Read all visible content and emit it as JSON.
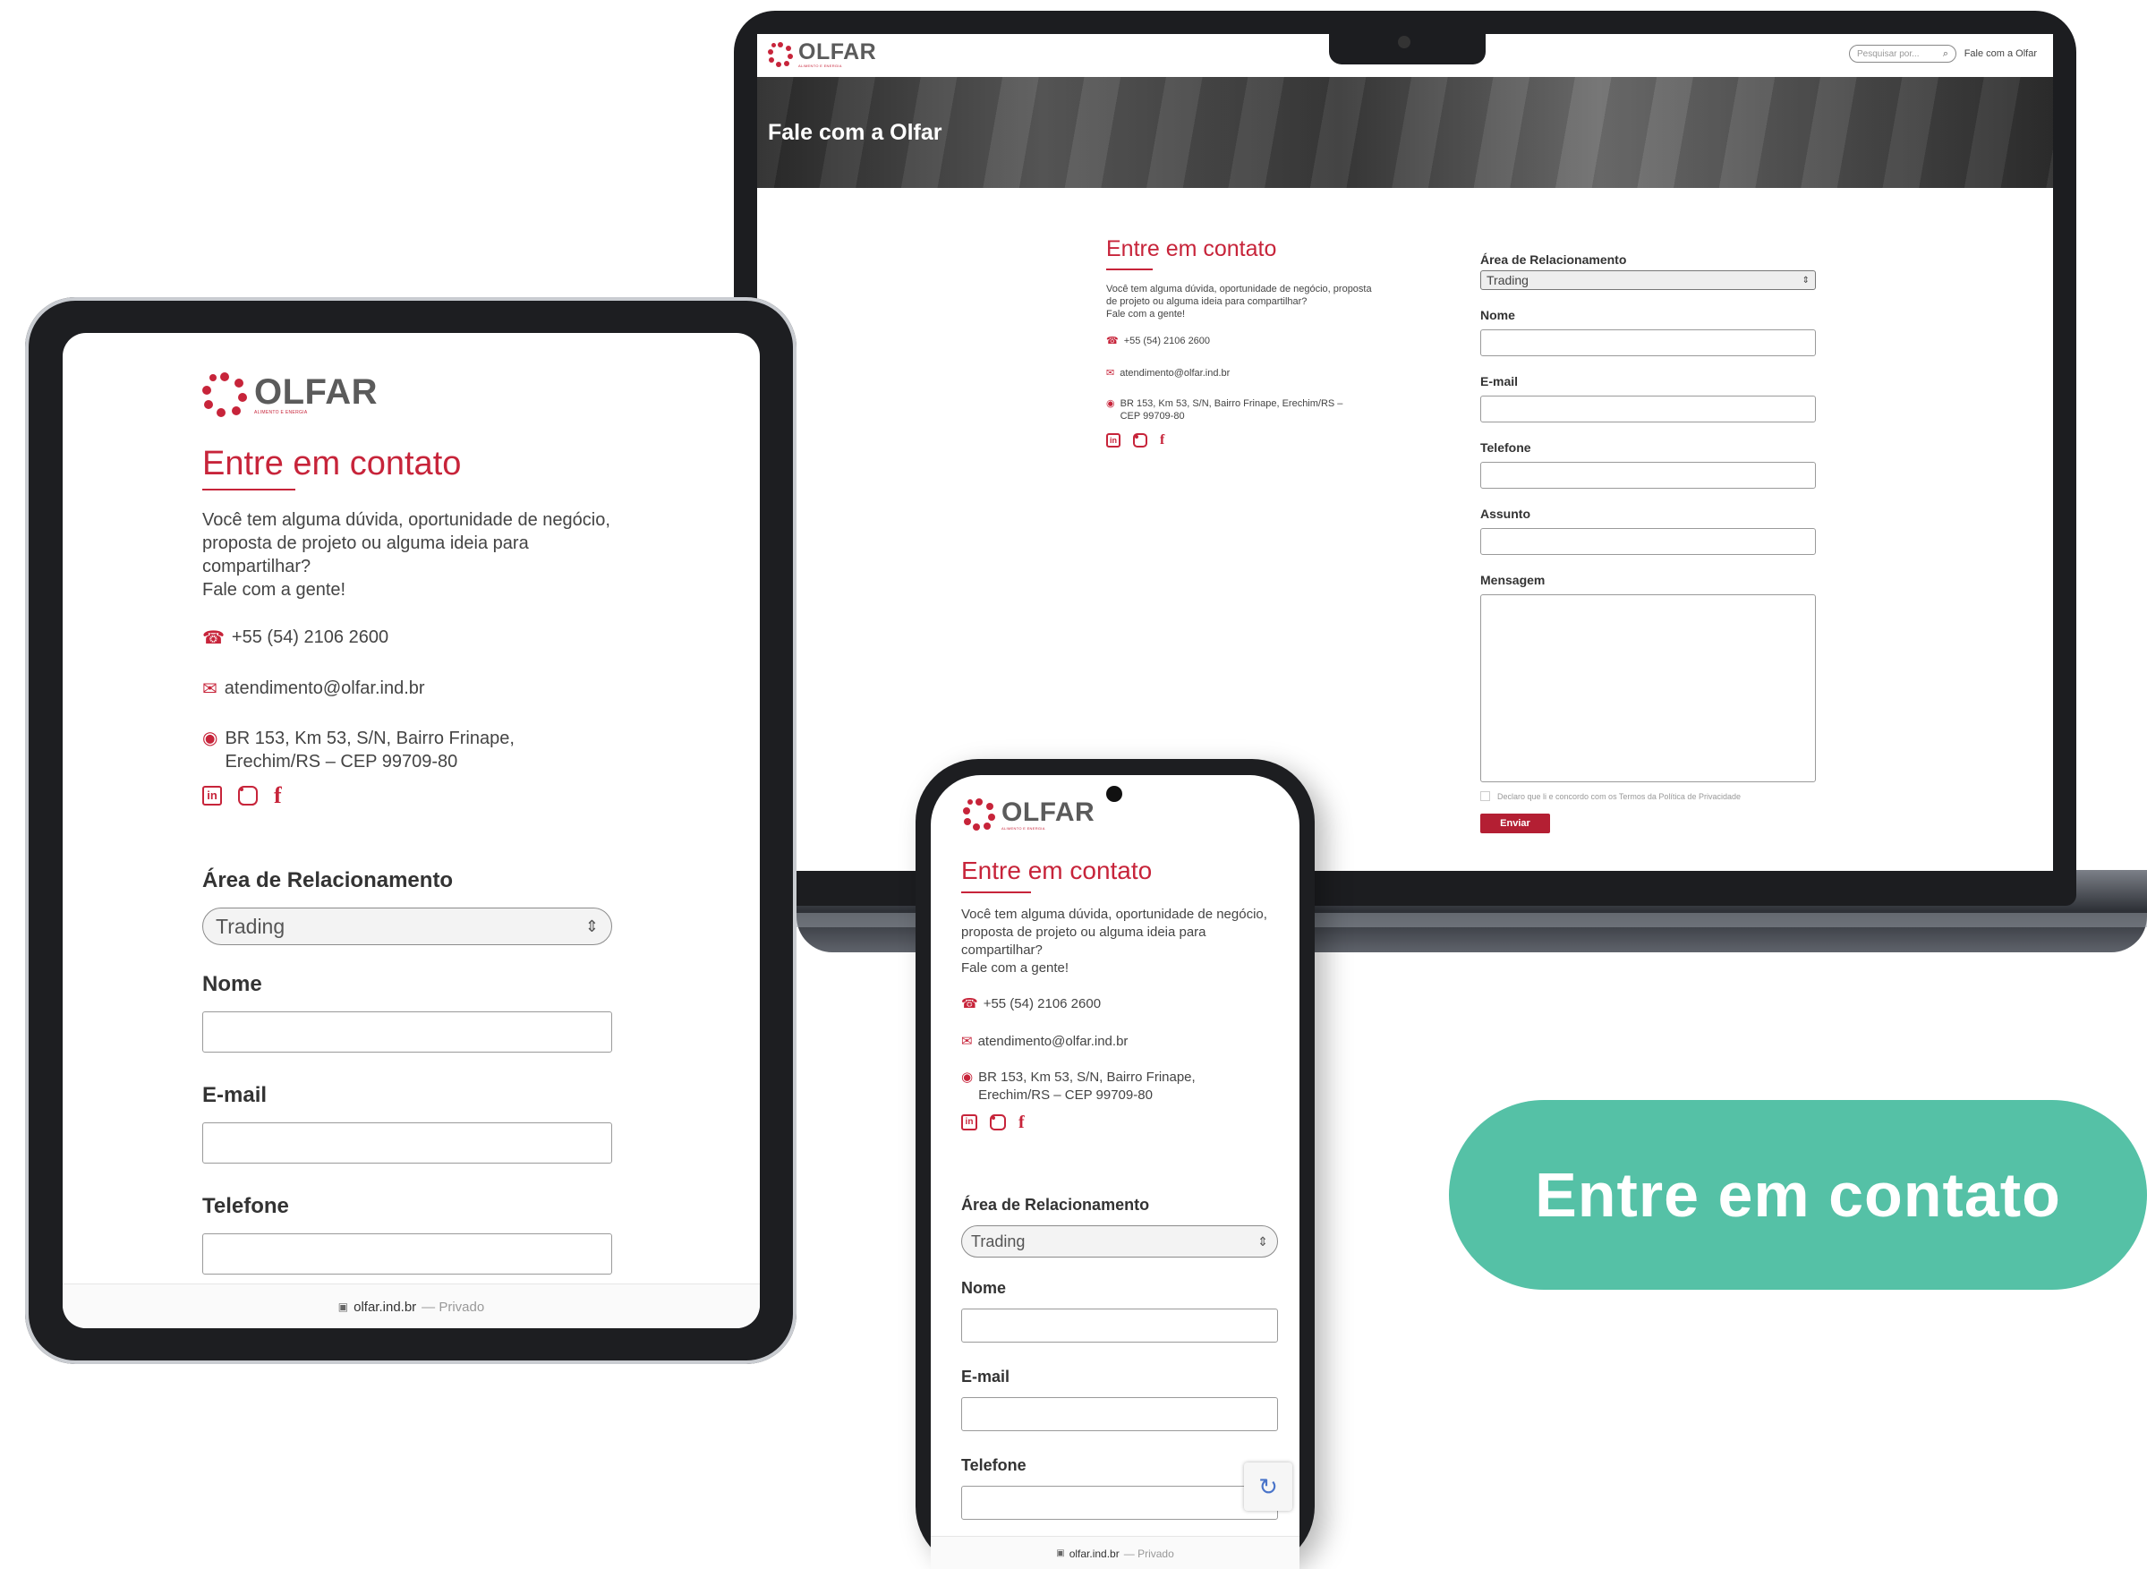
{
  "brand": {
    "name": "OLFAR",
    "tagline": "ALIMENTO E ENERGIA",
    "primary_color": "#c7243a",
    "cta_color": "#55c1a6"
  },
  "laptop": {
    "search_placeholder": "Pesquisar por...",
    "nav_link": "Fale com a Olfar",
    "hero_title": "Fale com a Olfar",
    "contact": {
      "title": "Entre em contato",
      "intro": "Você tem alguma dúvida, oportunidade de negócio, proposta de projeto ou alguma ideia para compartilhar?",
      "intro_line2": "Fale com a gente!",
      "phone": "+55 (54) 2106 2600",
      "email": "atendimento@olfar.ind.br",
      "address_line1": "BR 153, Km 53, S/N, Bairro Frinape, Erechim/RS –",
      "address_line2": "CEP 99709-80"
    },
    "form": {
      "area_label": "Área de Relacionamento",
      "area_value": "Trading",
      "name_label": "Nome",
      "email_label": "E-mail",
      "phone_label": "Telefone",
      "subject_label": "Assunto",
      "message_label": "Mensagem",
      "consent": "Declaro que li e concordo com os Termos da Política de Privacidade",
      "submit": "Enviar"
    }
  },
  "tablet": {
    "contact": {
      "title": "Entre em contato",
      "intro": "Você tem alguma dúvida, oportunidade de negócio, proposta de projeto ou alguma ideia para compartilhar?",
      "intro_line2": "Fale com a gente!",
      "phone": "+55 (54) 2106 2600",
      "email": "atendimento@olfar.ind.br",
      "address_line1": "BR 153, Km 53, S/N, Bairro Frinape,",
      "address_line2": "Erechim/RS – CEP 99709-80"
    },
    "form": {
      "area_label": "Área de Relacionamento",
      "area_value": "Trading",
      "name_label": "Nome",
      "email_label": "E-mail",
      "phone_label": "Telefone"
    },
    "url": "olfar.ind.br",
    "url_suffix": "— Privado"
  },
  "phone": {
    "contact": {
      "title": "Entre em contato",
      "intro": "Você tem alguma dúvida, oportunidade de negócio, proposta de projeto ou alguma ideia para compartilhar?",
      "intro_line2": "Fale com a gente!",
      "phone": "+55 (54) 2106 2600",
      "email": "atendimento@olfar.ind.br",
      "address_line1": "BR 153, Km 53, S/N, Bairro Frinape,",
      "address_line2": "Erechim/RS – CEP 99709-80"
    },
    "form": {
      "area_label": "Área de Relacionamento",
      "area_value": "Trading",
      "name_label": "Nome",
      "email_label": "E-mail",
      "phone_label": "Telefone"
    },
    "url": "olfar.ind.br",
    "url_suffix": "— Privado"
  },
  "cta": {
    "label": "Entre em contato"
  }
}
